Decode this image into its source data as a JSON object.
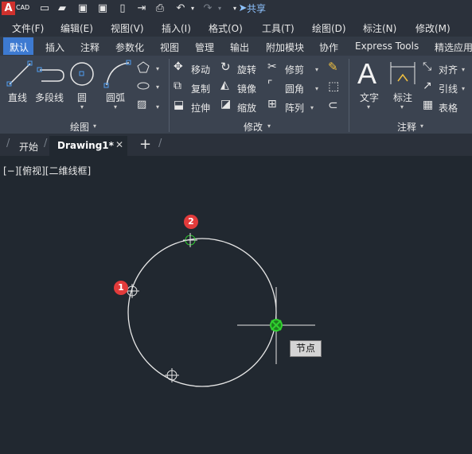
{
  "app": {
    "logo_letter": "A",
    "logo_text": "CAD",
    "share_label": "共享"
  },
  "menus": [
    "文件(F)",
    "编辑(E)",
    "视图(V)",
    "插入(I)",
    "格式(O)",
    "工具(T)",
    "绘图(D)",
    "标注(N)",
    "修改(M)"
  ],
  "ribbon_tabs": [
    "默认",
    "插入",
    "注释",
    "参数化",
    "视图",
    "管理",
    "输出",
    "附加模块",
    "协作",
    "Express Tools",
    "精选应用"
  ],
  "draw_panel": {
    "line": "直线",
    "polyline": "多段线",
    "circle": "圆",
    "arc": "圆弧",
    "title": "绘图"
  },
  "modify_panel": {
    "move": "移动",
    "rotate": "旋转",
    "trim": "修剪",
    "copy": "复制",
    "mirror": "镜像",
    "fillet": "圆角",
    "stretch": "拉伸",
    "scale": "缩放",
    "array": "阵列",
    "title": "修改"
  },
  "annotation_panel": {
    "text": "文字",
    "dimension": "标注",
    "align": "对齐",
    "leader": "引线",
    "table": "表格",
    "title": "注释"
  },
  "file_tabs": {
    "start": "开始",
    "drawing": "Drawing1*"
  },
  "viewport_label": "[−][俯视][二维线框]",
  "markers": {
    "one": "1",
    "two": "2"
  },
  "tooltip": "节点",
  "colors": {
    "accent": "#3d7ad1",
    "badge": "#e23b3b",
    "snap": "#2fd12f",
    "canvas": "#212830"
  }
}
